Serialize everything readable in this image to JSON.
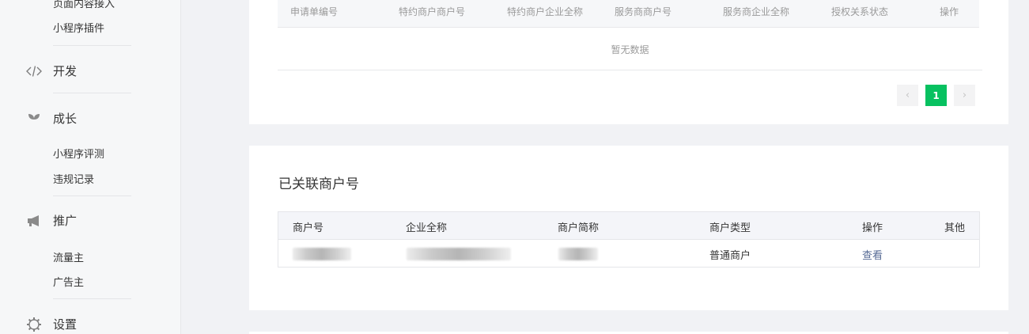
{
  "sidebar": {
    "top_partial_item": "页面内容接入",
    "plugin_item": "小程序插件",
    "develop": {
      "label": "开发",
      "icon": "code-icon"
    },
    "growth": {
      "label": "成长",
      "icon": "sprout-icon",
      "items": [
        "小程序评测",
        "违规记录"
      ]
    },
    "promotion": {
      "label": "推广",
      "icon": "megaphone-icon",
      "items": [
        "流量主",
        "广告主"
      ]
    },
    "settings": {
      "label": "设置",
      "icon": "gear-icon"
    }
  },
  "authorization_table": {
    "columns": [
      "申请单编号",
      "特约商户商户号",
      "特约商户企业全称",
      "服务商商户号",
      "服务商企业全称",
      "授权关系状态",
      "操作"
    ],
    "empty_text": "暂无数据",
    "pagination": {
      "prev": "‹",
      "current_page": "1",
      "next": "›"
    }
  },
  "linked_merchants": {
    "title": "已关联商户号",
    "columns": [
      "商户号",
      "企业全称",
      "商户简称",
      "商户类型",
      "操作",
      "其他"
    ],
    "rows": [
      {
        "merchant_type": "普通商户",
        "action": "查看"
      }
    ]
  },
  "colors": {
    "accent_green": "#07c160",
    "link_blue": "#576b95"
  }
}
